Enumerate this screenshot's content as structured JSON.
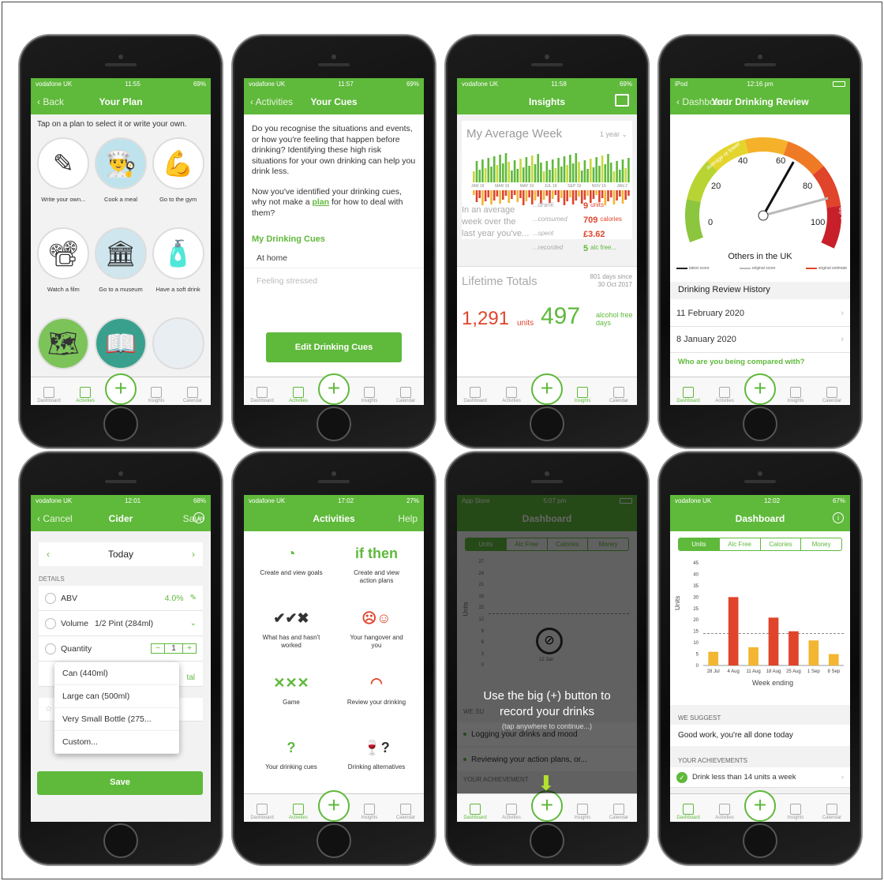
{
  "phones": [
    {
      "carrier": "vodafone UK",
      "time": "11:55",
      "battery": "69%",
      "nav_left": "Back",
      "nav_title": "Your Plan",
      "intro": "Tap on a plan to select it or write your own.",
      "plans": [
        {
          "label": "Write your own...",
          "icon": "✎",
          "bg": "#ffffff"
        },
        {
          "label": "Cook a meal",
          "icon": "👨‍🍳",
          "bg": "#bfe3ec"
        },
        {
          "label": "Go to the gym",
          "icon": "💪",
          "bg": "#ffffff"
        },
        {
          "label": "Watch a film",
          "icon": "📽",
          "bg": "#ffffff"
        },
        {
          "label": "Go to a museum",
          "icon": "🏛",
          "bg": "#cfe6ee"
        },
        {
          "label": "Have a soft drink",
          "icon": "🧴",
          "bg": "#ffffff"
        },
        {
          "label": "",
          "icon": "🗺",
          "bg": "#7cc35a"
        },
        {
          "label": "",
          "icon": "📖",
          "bg": "#3aa08e"
        },
        {
          "label": "",
          "icon": "",
          "bg": "#e9eef3"
        }
      ]
    },
    {
      "carrier": "vodafone UK",
      "time": "11:57",
      "battery": "69%",
      "nav_left": "Activities",
      "nav_title": "Your Cues",
      "para1": "Do you recognise the situations and events, or how you're feeling that happen before drinking? Identifying these high risk situations for your own drinking can help you drink less.",
      "para2_a": "Now you've identified your drinking cues, why not make a ",
      "para2_link": "plan",
      "para2_b": " for how to deal with them?",
      "section": "My Drinking Cues",
      "cue1": "At home",
      "cue2": "Feeling stressed",
      "button": "Edit Drinking Cues"
    },
    {
      "carrier": "vodafone UK",
      "time": "11:58",
      "battery": "69%",
      "nav_title": "Insights",
      "card_title": "My Average Week",
      "range": "1 year",
      "months": [
        "JAN 19",
        "MAR 19",
        "MAY 19",
        "JUL 19",
        "SEP 19",
        "NOV 19",
        "JAN 2"
      ],
      "avg_text": "In an average week over the last year you've...",
      "stats": [
        {
          "label": "...drank",
          "value": "9",
          "unit": "units"
        },
        {
          "label": "...consumed",
          "value": "709",
          "unit": "calories"
        },
        {
          "label": "...spent",
          "value": "£3.62",
          "unit": ""
        },
        {
          "label": "...recorded",
          "value": "5",
          "unit": "alc free..."
        }
      ],
      "lifetime": "Lifetime Totals",
      "days_since": "801 days since",
      "since_date": "30 Oct 2017",
      "units_total": "1,291",
      "units_label": "units",
      "free_total": "497",
      "free_label": "alcohol free days"
    },
    {
      "carrier": "iPod",
      "time": "12:16 pm",
      "nav_left": "Dashboard",
      "nav_title": "Your Drinking Review",
      "gauge": {
        "ticks": [
          "0",
          "20",
          "40",
          "60",
          "80",
          "100"
        ],
        "arc_top": "average or lower",
        "arc_high": "high",
        "arc_top10": "top 10%",
        "value": 62
      },
      "gauge_title": "Others in the UK",
      "legend": [
        "latest score",
        "original score",
        "original estimate"
      ],
      "history_title": "Drinking Review History",
      "history": [
        "11 February 2020",
        "8 January 2020"
      ],
      "compare_link": "Who are you being compared with?"
    },
    {
      "carrier": "vodafone UK",
      "time": "12:01",
      "battery": "68%",
      "nav_left": "Cancel",
      "nav_title": "Cider",
      "nav_right": "Save",
      "date": "Today",
      "details": "DETAILS",
      "abv_label": "ABV",
      "abv_value": "4.0%",
      "volume_label": "Volume",
      "volume_value": "1/2 Pint (284ml)",
      "quantity_label": "Quantity",
      "quantity_value": "1",
      "dropdown": [
        "Can (440ml)",
        "Large can (500ml)",
        "Very Small Bottle (275...",
        "Custom..."
      ],
      "partial": "tal",
      "save": "Save"
    },
    {
      "carrier": "vodafone UK",
      "time": "17:02",
      "battery": "27%",
      "nav_title": "Activities",
      "nav_right": "Help",
      "items": [
        {
          "label": "Create and view goals",
          "icon": "◔"
        },
        {
          "label": "Create and view action plans",
          "icon": "if then"
        },
        {
          "label": "What has and hasn't worked",
          "icon": "✔✔✖"
        },
        {
          "label": "Your hangover and you",
          "icon": "☹☺"
        },
        {
          "label": "Game",
          "icon": "✕✕✕"
        },
        {
          "label": "Review your drinking",
          "icon": "◠"
        },
        {
          "label": "Your drinking cues",
          "icon": "?"
        },
        {
          "label": "Drinking alternatives",
          "icon": "🍷?"
        }
      ]
    },
    {
      "carrier": "App Store",
      "time": "5:07 pm",
      "nav_title": "Dashboard",
      "segments": [
        "Units",
        "Alc Free",
        "Calories",
        "Money"
      ],
      "yticks": [
        "27",
        "24",
        "21",
        "18",
        "15",
        "12",
        "9",
        "6",
        "3",
        "0"
      ],
      "ylabel": "Units",
      "overlay_line1": "Use the big (+) button to",
      "overlay_line2": "record your drinks",
      "overlay_hint": "(tap anywhere to continue...)",
      "suggest_partial": "WE SU",
      "list": [
        "Logging your drinks and mood",
        "Reviewing your action plans, or..."
      ],
      "achieve_partial": "YOUR ACHIEVEMENT",
      "x_partial": "12 Jan"
    },
    {
      "carrier": "vodafone UK",
      "time": "12:02",
      "battery": "67%",
      "nav_title": "Dashboard",
      "segments": [
        "Units",
        "Alc Free",
        "Calories",
        "Money"
      ],
      "chart_data": {
        "type": "bar",
        "categories": [
          "28 Jul",
          "4 Aug",
          "11 Aug",
          "18 Aug",
          "25 Aug",
          "1 Sep",
          "8 Sep"
        ],
        "values": [
          6,
          30,
          8,
          21,
          15,
          11,
          5
        ],
        "ylabel": "Units",
        "xlabel": "Week ending",
        "ylim": [
          0,
          45
        ],
        "yticks": [
          0,
          5,
          10,
          15,
          20,
          25,
          30,
          35,
          40,
          45
        ],
        "reference_line": 14,
        "bar_color": "#e0452b",
        "light_color": "#f2b632"
      },
      "suggest_title": "WE SUGGEST",
      "suggest_text": "Good work, you're all done today",
      "achieve_title": "YOUR ACHIEVEMENTS",
      "achieve_text": "Drink less than 14 units a week"
    }
  ],
  "tabs": [
    "Dashboard",
    "Activities",
    "Insights",
    "Calendar"
  ]
}
